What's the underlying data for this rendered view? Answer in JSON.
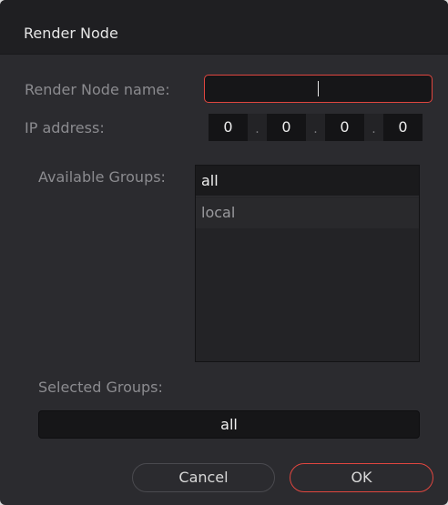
{
  "window": {
    "title": "Render Node"
  },
  "form": {
    "name_label": "Render Node name:",
    "name_value": "",
    "ip_label": "IP address:",
    "ip_octets": [
      "0",
      "0",
      "0",
      "0"
    ],
    "ip_separator": ".",
    "available_groups_label": "Available Groups:",
    "available_groups": [
      {
        "label": "all",
        "selected": true
      },
      {
        "label": "local",
        "selected": false
      }
    ],
    "selected_groups_label": "Selected Groups:",
    "selected_groups_value": "all"
  },
  "buttons": {
    "cancel_label": "Cancel",
    "ok_label": "OK"
  },
  "colors": {
    "accent": "#e0463f",
    "dialog_background": "#2b2b2f",
    "titlebar_background": "#1f1f22"
  }
}
